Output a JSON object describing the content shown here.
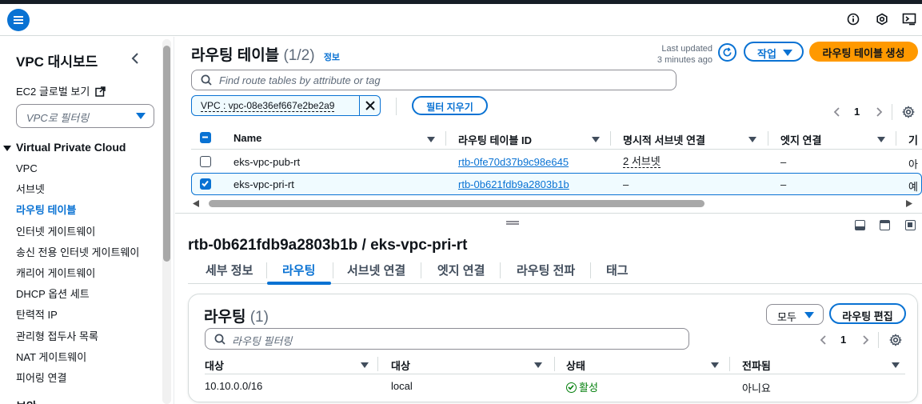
{
  "topbar": {
    "icons": [
      "menu-icon",
      "info-icon",
      "settings-hex-icon",
      "cloudshell-icon"
    ]
  },
  "sidebar": {
    "title": "VPC 대시보드",
    "ec2_link": "EC2 글로벌 보기",
    "filter_placeholder": "VPC로 필터링",
    "section": "Virtual Private Cloud",
    "items": [
      {
        "label": "VPC"
      },
      {
        "label": "서브넷"
      },
      {
        "label": "라우팅 테이블"
      },
      {
        "label": "인터넷 게이트웨이"
      },
      {
        "label": "송신 전용 인터넷 게이트웨이"
      },
      {
        "label": "캐리어 게이트웨이"
      },
      {
        "label": "DHCP 옵션 세트"
      },
      {
        "label": "탄력적 IP"
      },
      {
        "label": "관리형 접두사 목록"
      },
      {
        "label": "NAT 게이트웨이"
      },
      {
        "label": "피어링 연결"
      }
    ],
    "active_item": "라우팅 테이블",
    "next_section": "보안"
  },
  "header": {
    "title": "라우팅 테이블",
    "count": "(1/2)",
    "info": "정보",
    "last_updated_label": "Last updated",
    "last_updated_value": "3 minutes ago",
    "actions_label": "작업",
    "create_label": "라우팅 테이블 생성"
  },
  "search": {
    "placeholder": "Find route tables by attribute or tag"
  },
  "filter_token": {
    "text": "VPC : vpc-08e36ef667e2be2a9"
  },
  "clear_filters_label": "필터 지우기",
  "pagination": {
    "page": "1"
  },
  "table": {
    "columns": [
      "Name",
      "라우팅 테이블 ID",
      "명시적 서브넷 연결",
      "엣지 연결",
      "기"
    ],
    "rows": [
      {
        "name": "eks-vpc-pub-rt",
        "id": "rtb-0fe70d37b9c98e645",
        "subnets": "2 서브넷",
        "edge": "–",
        "extra": "아",
        "selected": false
      },
      {
        "name": "eks-vpc-pri-rt",
        "id": "rtb-0b621fdb9a2803b1b",
        "subnets": "–",
        "edge": "–",
        "extra": "예",
        "selected": true
      }
    ]
  },
  "detail": {
    "title": "rtb-0b621fdb9a2803b1b / eks-vpc-pri-rt",
    "tabs": [
      {
        "label": "세부 정보"
      },
      {
        "label": "라우팅"
      },
      {
        "label": "서브넷 연결"
      },
      {
        "label": "엣지 연결"
      },
      {
        "label": "라우팅 전파"
      },
      {
        "label": "태그"
      }
    ],
    "active_tab": "라우팅"
  },
  "routes_panel": {
    "title": "라우팅",
    "count": "(1)",
    "filter_select": "모두",
    "edit_label": "라우팅 편집",
    "search_placeholder": "라우팅 필터링",
    "page": "1",
    "columns": [
      "대상",
      "대상",
      "상태",
      "전파됨"
    ],
    "rows": [
      {
        "destination": "10.10.0.0/16",
        "target": "local",
        "status": "활성",
        "propagated": "아니요"
      }
    ]
  },
  "colors": {
    "primary": "#0972d3",
    "cta": "#ff9900",
    "success": "#037f0c",
    "text": "#0f141a"
  }
}
